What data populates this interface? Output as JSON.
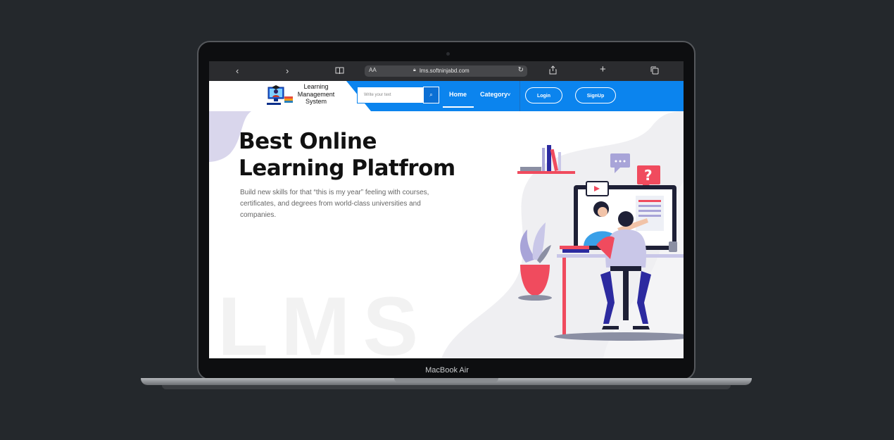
{
  "device": {
    "label": "MacBook Air"
  },
  "browser": {
    "back_icon": "chevron-left-icon",
    "forward_icon": "chevron-right-icon",
    "reader_icon": "book-icon",
    "text_size": "AA",
    "url": "lms.softninjabd.com",
    "reload_icon": "reload-icon",
    "share_icon": "share-icon",
    "new_tab_icon": "plus-icon",
    "tabs_icon": "tabs-icon"
  },
  "site": {
    "logo_lines": [
      "Learning",
      "Management",
      "System"
    ],
    "search": {
      "placeholder": "Write your text"
    },
    "nav": {
      "home": "Home",
      "category": "Category",
      "login": "Login",
      "signup": "SignUp"
    },
    "colors": {
      "primary": "#0b84ee",
      "accent": "#f04b5e",
      "illustration_purple": "#3a2fa0"
    }
  },
  "hero": {
    "title_line1": "Best Online",
    "title_line2": "Learning Platfrom",
    "description": "Build new skills for that “this is my year” feeling with courses, certificates, and degrees from world-class universities and companies.",
    "watermark": "LMS"
  }
}
